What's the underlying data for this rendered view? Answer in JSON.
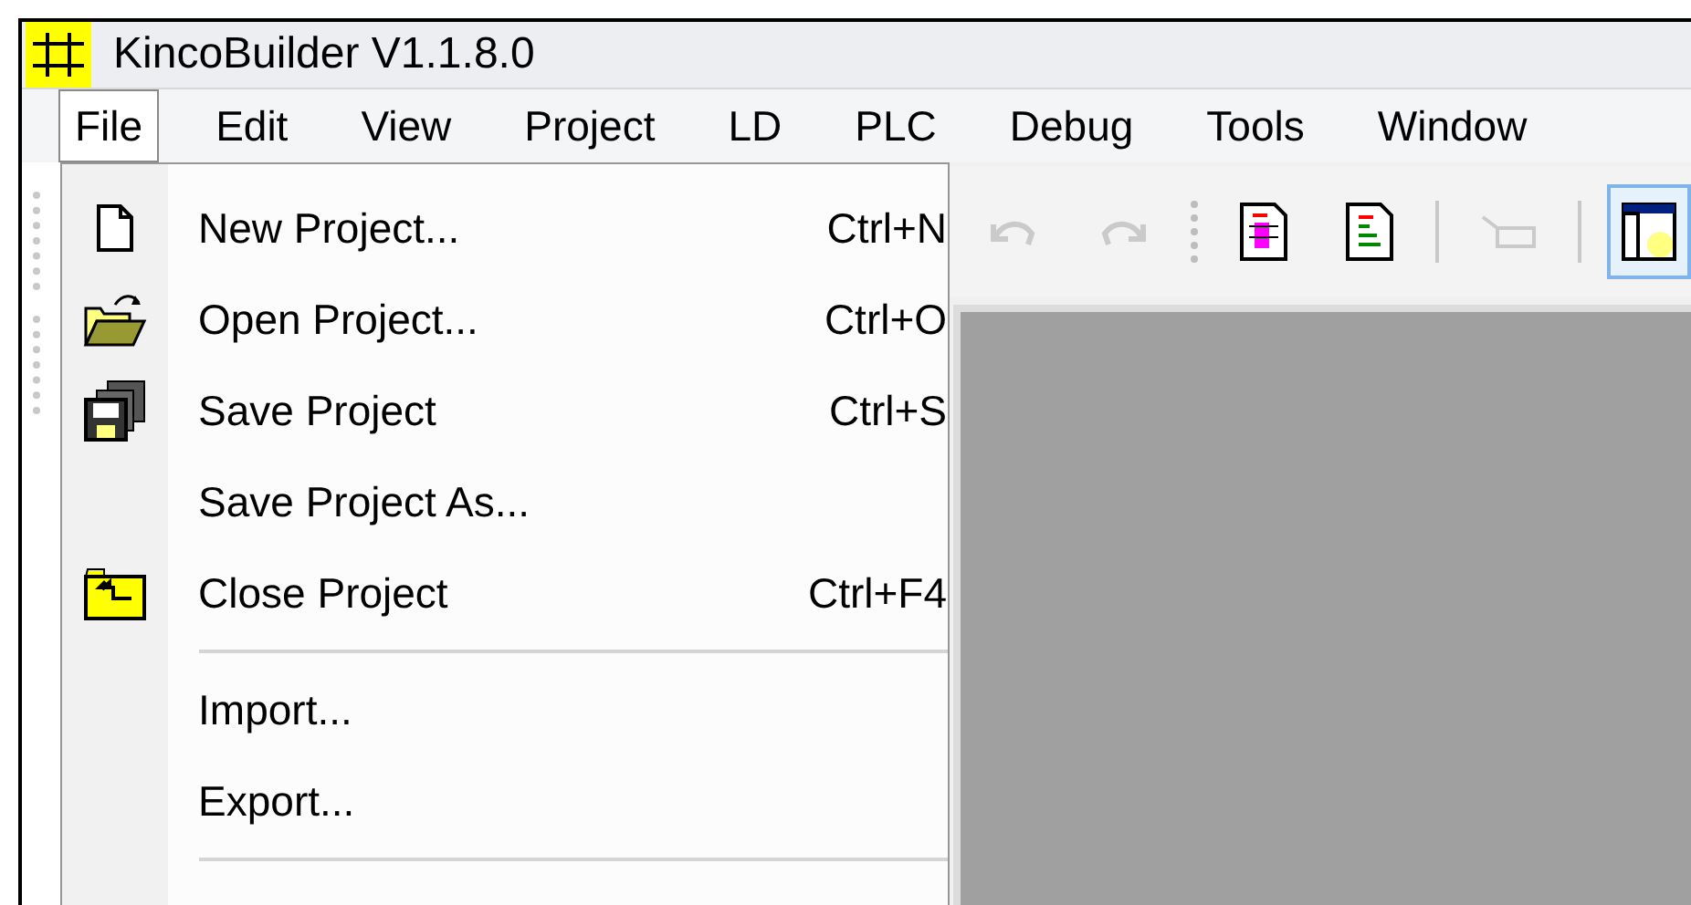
{
  "window": {
    "title": "KincoBuilder V1.1.8.0"
  },
  "menu_bar": [
    {
      "label": "File",
      "selected": true
    },
    {
      "label": "Edit",
      "selected": false
    },
    {
      "label": "View",
      "selected": false
    },
    {
      "label": "Project",
      "selected": false
    },
    {
      "label": "LD",
      "selected": false
    },
    {
      "label": "PLC",
      "selected": false
    },
    {
      "label": "Debug",
      "selected": false
    },
    {
      "label": "Tools",
      "selected": false
    },
    {
      "label": "Window",
      "selected": false
    }
  ],
  "toolbar": [
    {
      "kind": "undo",
      "disabled": true,
      "pressed": false
    },
    {
      "kind": "redo",
      "disabled": true,
      "pressed": false
    },
    {
      "kind": "grip"
    },
    {
      "kind": "ladder-doc",
      "disabled": false,
      "pressed": false
    },
    {
      "kind": "list-doc",
      "disabled": false,
      "pressed": false
    },
    {
      "kind": "separator"
    },
    {
      "kind": "comment",
      "disabled": true,
      "pressed": false
    },
    {
      "kind": "separator"
    },
    {
      "kind": "window-layout",
      "disabled": false,
      "pressed": true
    }
  ],
  "file_menu": [
    {
      "kind": "new",
      "label": "New Project...",
      "shortcut": "Ctrl+N"
    },
    {
      "kind": "open",
      "label": "Open Project...",
      "shortcut": "Ctrl+O"
    },
    {
      "kind": "save",
      "label": "Save Project",
      "shortcut": "Ctrl+S"
    },
    {
      "kind": "plain",
      "label": "Save Project As..."
    },
    {
      "kind": "close",
      "label": "Close Project",
      "shortcut": "Ctrl+F4"
    },
    {
      "kind": "separator"
    },
    {
      "kind": "plain",
      "label": "Import..."
    },
    {
      "kind": "plain",
      "label": "Export..."
    },
    {
      "kind": "separator"
    }
  ]
}
